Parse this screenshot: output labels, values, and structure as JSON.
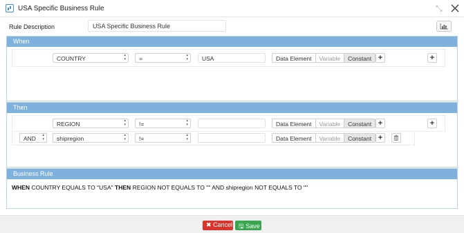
{
  "window": {
    "title": "USA Specific Business Rule",
    "icon": "app-window-icon"
  },
  "description": {
    "label": "Rule Description",
    "value": "USA Specific Business Rule"
  },
  "when": {
    "header": "When",
    "row": {
      "field": "COUNTRY",
      "operator": "=",
      "value": "USA",
      "modes": [
        "Data Element",
        "Variable",
        "Constant"
      ],
      "active_mode": "Constant",
      "add_label": "+"
    },
    "add_group_label": "+"
  },
  "then": {
    "header": "Then",
    "rows": [
      {
        "connector": "",
        "field": "REGION",
        "operator": "!=",
        "value": "",
        "modes": [
          "Data Element",
          "Variable",
          "Constant"
        ],
        "add_label": "+"
      },
      {
        "connector": "AND",
        "field": "shipregion",
        "operator": "!=",
        "value": "",
        "modes": [
          "Data Element",
          "Variable",
          "Constant"
        ],
        "add_label": "+"
      }
    ],
    "add_group_label": "+"
  },
  "business_rule": {
    "header": "Business Rule",
    "kw_when": "WHEN",
    "part1": "COUNTRY EQUALS TO \"USA\"",
    "kw_then": "THEN",
    "part2": "REGION NOT EQUALS TO \"\" AND shipregion NOT EQUALS TO \"\""
  },
  "footer": {
    "cancel_label": "Cancel",
    "save_label": "Save"
  },
  "colors": {
    "panel_header": "#7fb1dd",
    "cancel": "#d9342b",
    "save": "#3aa54f"
  }
}
